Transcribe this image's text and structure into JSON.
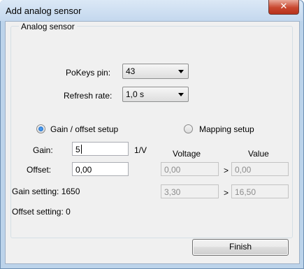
{
  "window": {
    "title": "Add analog sensor",
    "close_glyph": "✕"
  },
  "group": {
    "label": "Analog sensor"
  },
  "pokeys_pin": {
    "label": "PoKeys pin:",
    "value": "43"
  },
  "refresh_rate": {
    "label": "Refresh rate:",
    "value": "1,0 s"
  },
  "mode": {
    "gain_offset_label": "Gain / offset setup",
    "mapping_label": "Mapping setup",
    "selected": "gain_offset"
  },
  "gain": {
    "label": "Gain:",
    "value": "5",
    "unit": "1/V"
  },
  "offset": {
    "label": "Offset:",
    "value": "0,00"
  },
  "mapping": {
    "voltage_header": "Voltage",
    "value_header": "Value",
    "arrow": ">",
    "rows": [
      {
        "voltage": "0,00",
        "value": "0,00"
      },
      {
        "voltage": "3,30",
        "value": "16,50"
      }
    ]
  },
  "status": {
    "gain_setting": "Gain setting: 1650",
    "offset_setting": "Offset setting: 0"
  },
  "buttons": {
    "finish": "Finish"
  }
}
